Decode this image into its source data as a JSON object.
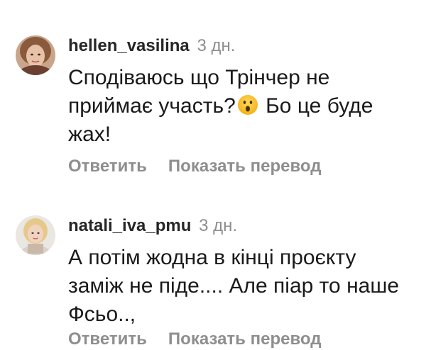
{
  "comments": [
    {
      "username": "hellen_vasilina",
      "time": "3 дн.",
      "text_before": "Сподіваюсь що Трінчер не приймає участь?",
      "text_after": " Бо це буде жах!",
      "emoji": "surprised-face",
      "reply_label": "Ответить",
      "translate_label": "Показать перевод"
    },
    {
      "username": "natali_iva_pmu",
      "time": "3 дн.",
      "text": "А потім жодна в кінці проєкту заміж не піде.... Але піар то наше Фсьо..,",
      "reply_label": "Ответить",
      "translate_label": "Показать перевод"
    }
  ],
  "colors": {
    "username": "#262626",
    "secondary": "#8e8e8e",
    "text": "#1a1a1a"
  }
}
